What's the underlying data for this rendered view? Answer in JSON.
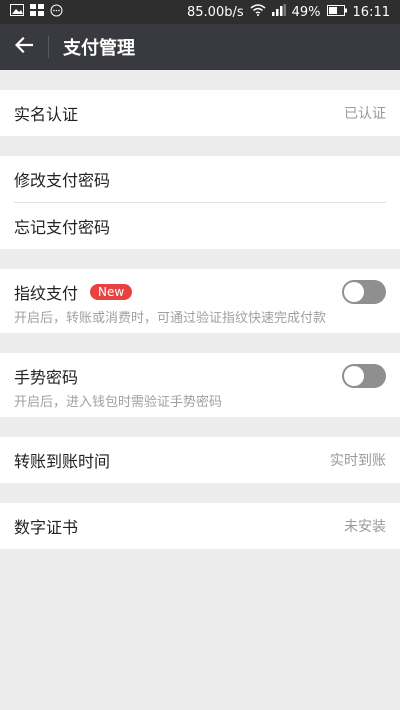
{
  "status_bar": {
    "speed": "85.00b/s",
    "battery": "49%",
    "time": "16:11"
  },
  "header": {
    "title": "支付管理"
  },
  "sections": {
    "realname": {
      "label": "实名认证",
      "value": "已认证"
    },
    "password": {
      "modify": "修改支付密码",
      "forgot": "忘记支付密码"
    },
    "fingerprint": {
      "label": "指纹支付",
      "badge": "New",
      "desc": "开启后，转账或消费时，可通过验证指纹快速完成付款"
    },
    "gesture": {
      "label": "手势密码",
      "desc": "开启后，进入钱包时需验证手势密码"
    },
    "transfer": {
      "label": "转账到账时间",
      "value": "实时到账"
    },
    "certificate": {
      "label": "数字证书",
      "value": "未安装"
    }
  }
}
